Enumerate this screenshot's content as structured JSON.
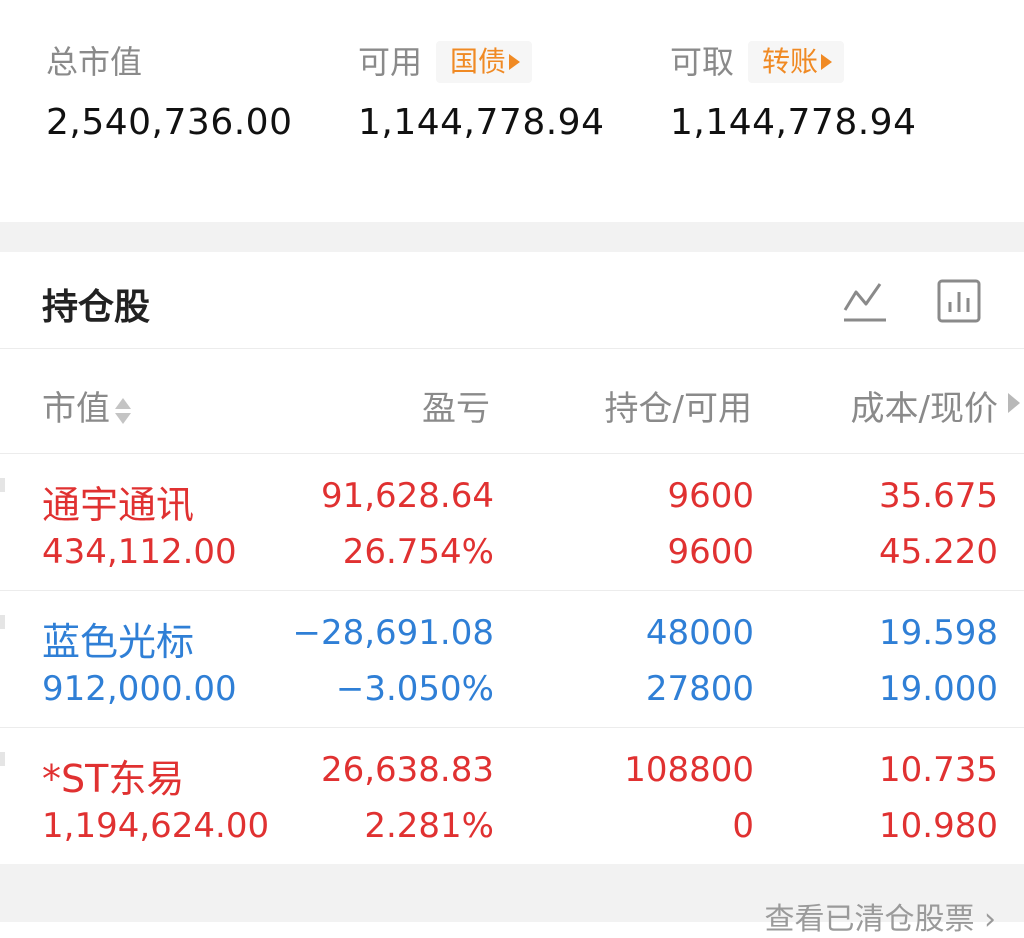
{
  "summary": {
    "total_label": "总市值",
    "total_value": "2,540,736.00",
    "available_label": "可用",
    "available_tag": "国债",
    "available_value": "1,144,778.94",
    "withdrawable_label": "可取",
    "withdrawable_tag": "转账",
    "withdrawable_value": "1,144,778.94"
  },
  "holdings": {
    "title": "持仓股",
    "icons": [
      "line-chart-icon",
      "bar-chart-icon"
    ],
    "columns": {
      "market_value": "市值",
      "profit_loss": "盈亏",
      "position_available": "持仓/可用",
      "cost_price": "成本/现价"
    },
    "rows": [
      {
        "name": "通宇通讯",
        "market_value": "434,112.00",
        "pnl": "91,628.64",
        "pnl_pct": "26.754%",
        "position": "9600",
        "available": "9600",
        "cost": "35.675",
        "price": "45.220",
        "color": "#e03131"
      },
      {
        "name": "蓝色光标",
        "market_value": "912,000.00",
        "pnl": "−28,691.08",
        "pnl_pct": "−3.050%",
        "position": "48000",
        "available": "27800",
        "cost": "19.598",
        "price": "19.000",
        "color": "#2f7fd6"
      },
      {
        "name": "*ST东易",
        "market_value": "1,194,624.00",
        "pnl": "26,638.83",
        "pnl_pct": "2.281%",
        "position": "108800",
        "available": "0",
        "cost": "10.735",
        "price": "10.980",
        "color": "#e03131"
      }
    ]
  },
  "footer": {
    "history_link": "查看已清仓股票"
  },
  "colors": {
    "profit": "#e03131",
    "loss": "#2f7fd6",
    "tag": "#f08a24"
  }
}
